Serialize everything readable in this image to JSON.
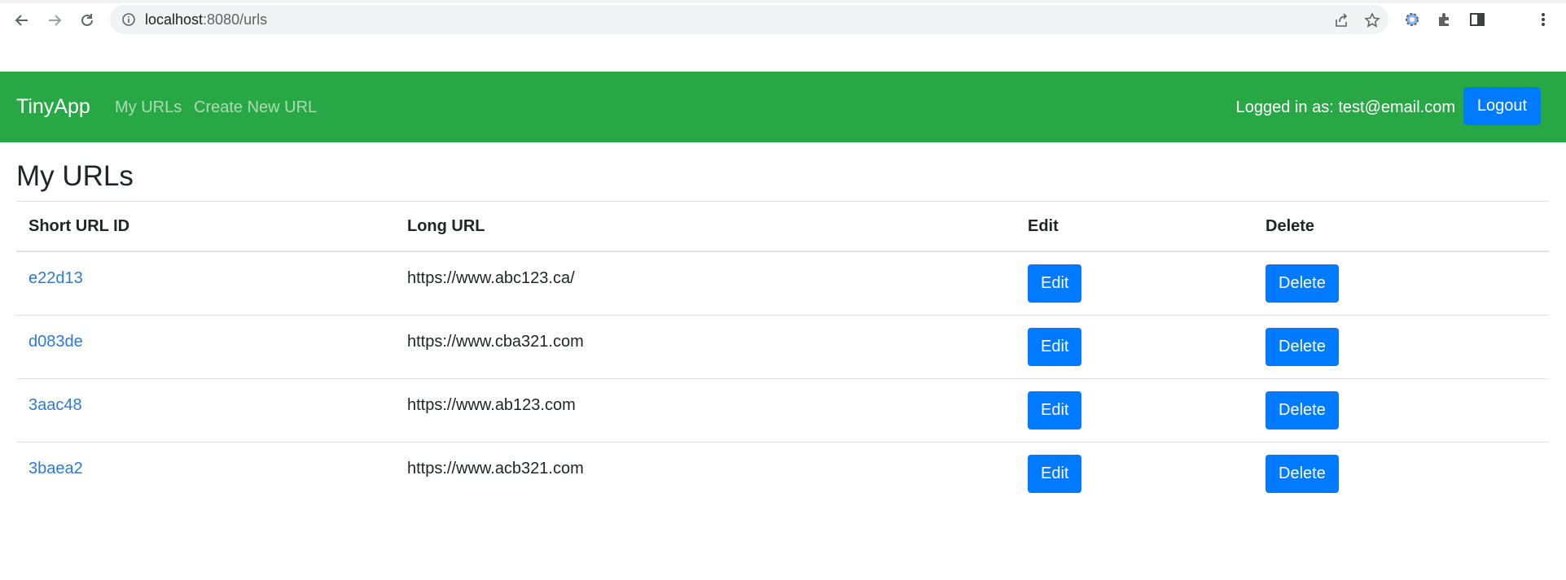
{
  "browser": {
    "url_host": "localhost",
    "url_path": ":8080/urls"
  },
  "navbar": {
    "brand": "TinyApp",
    "links": [
      {
        "label": "My URLs"
      },
      {
        "label": "Create New URL"
      }
    ],
    "logged_in_text": "Logged in as: test@email.com",
    "logout_label": "Logout",
    "bg_color": "#28a745",
    "button_color": "#007bff"
  },
  "main": {
    "title": "My URLs",
    "table": {
      "headers": [
        "Short URL ID",
        "Long URL",
        "Edit",
        "Delete"
      ],
      "rows": [
        {
          "short_id": "e22d13",
          "long_url": "https://www.abc123.ca/",
          "edit": "Edit",
          "delete": "Delete"
        },
        {
          "short_id": "d083de",
          "long_url": "https://www.cba321.com",
          "edit": "Edit",
          "delete": "Delete"
        },
        {
          "short_id": "3aac48",
          "long_url": "https://www.ab123.com",
          "edit": "Edit",
          "delete": "Delete"
        },
        {
          "short_id": "3baea2",
          "long_url": "https://www.acb321.com",
          "edit": "Edit",
          "delete": "Delete"
        }
      ]
    }
  },
  "icons": [
    "back-arrow-icon",
    "forward-arrow-icon",
    "reload-icon",
    "info-icon",
    "share-icon",
    "star-icon",
    "extension-gear-icon",
    "puzzle-icon",
    "side-panel-icon",
    "more-menu-icon"
  ]
}
